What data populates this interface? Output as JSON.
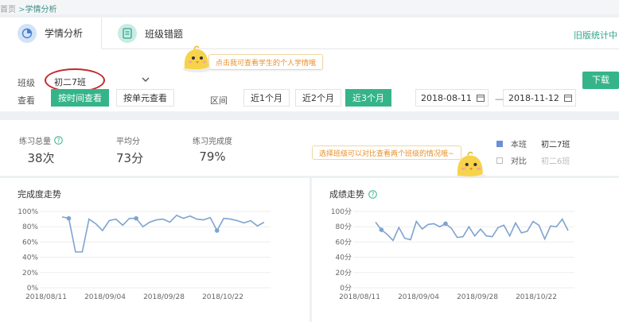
{
  "breadcrumb": {
    "home": "首页",
    "sep": " >",
    "current": "学情分析"
  },
  "tabs": [
    {
      "label": "学情分析"
    },
    {
      "label": "班级错题"
    }
  ],
  "old_link": "旧版统计中",
  "tooltip_class": "点击我可查看学生的个人学情哦",
  "class_filter": {
    "label": "班级",
    "value": "初二7班"
  },
  "download": "下载",
  "view": {
    "label": "查看",
    "options": [
      "按时间查看",
      "按单元查看"
    ],
    "selected": "按时间查看"
  },
  "range": {
    "label": "区间",
    "options": [
      "近1个月",
      "近2个月",
      "近3个月"
    ],
    "selected": "近3个月",
    "start": "2018-08-11",
    "end": "2018-11-12",
    "dash": "—"
  },
  "stats": [
    {
      "label": "练习总量",
      "value": "38次"
    },
    {
      "label": "平均分",
      "value": "73分"
    },
    {
      "label": "练习完成度",
      "value": "79%"
    }
  ],
  "legend": {
    "this_class": {
      "label": "本班",
      "value": "初二7班",
      "color": "#6b8fd4"
    },
    "compare": {
      "label": "对比",
      "value": "初二6班"
    }
  },
  "tooltip_compare": "选择班级可以对比查看两个班级的情况哦~",
  "accent": "#35b489",
  "line_color": "#7ea3cf",
  "chart_data": [
    {
      "type": "line",
      "title": "完成度走势",
      "y_ticks": [
        "100%",
        "80%",
        "60%",
        "40%",
        "20%",
        "0%"
      ],
      "ylim": [
        0,
        100
      ],
      "x_ticks": [
        "2018/08/11",
        "2018/09/04",
        "2018/09/28",
        "2018/10/22"
      ],
      "series": [
        {
          "values": [
            93,
            91,
            47,
            47,
            90,
            84,
            75,
            88,
            90,
            82,
            91,
            91,
            80,
            86,
            89,
            90,
            86,
            95,
            91,
            94,
            90,
            89,
            92,
            75,
            91,
            90,
            88,
            85,
            88,
            81,
            86
          ]
        }
      ],
      "markers": [
        1,
        11,
        23
      ]
    },
    {
      "type": "line",
      "title": "成绩走势",
      "y_ticks": [
        "100分",
        "80分",
        "60分",
        "40分",
        "20分",
        "0分"
      ],
      "ylim": [
        0,
        100
      ],
      "x_ticks": [
        "2018/08/11",
        "2018/09/04",
        "2018/09/28",
        "2018/10/22"
      ],
      "series": [
        {
          "values": [
            86,
            76,
            70,
            62,
            79,
            65,
            63,
            87,
            77,
            83,
            84,
            80,
            84,
            78,
            66,
            67,
            80,
            68,
            77,
            68,
            67,
            79,
            82,
            68,
            85,
            72,
            74,
            87,
            82,
            64,
            81,
            80,
            90,
            75
          ]
        }
      ],
      "markers": [
        1,
        12
      ]
    }
  ]
}
